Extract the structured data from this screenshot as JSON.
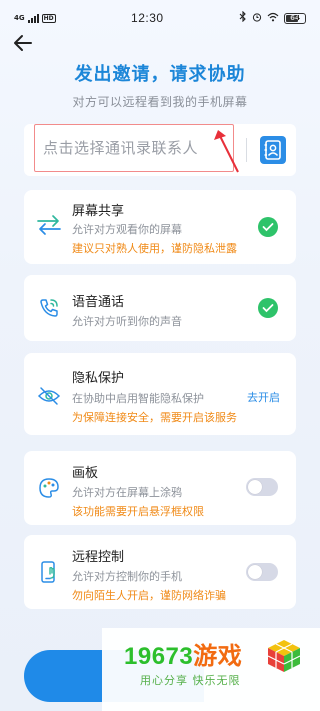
{
  "status_bar": {
    "network": "4G",
    "hd": "HD",
    "time": "12:30",
    "battery": "64"
  },
  "header": {
    "title": "发出邀请，请求协助",
    "subtitle": "对方可以远程看到我的手机屏幕"
  },
  "contact": {
    "placeholder": "点击选择通讯录联系人"
  },
  "cards": [
    {
      "title": "屏幕共享",
      "desc": "允许对方观看你的屏幕",
      "warn": "建议只对熟人使用，谨防隐私泄露",
      "icon": "swap-arrows-icon",
      "state": "checked"
    },
    {
      "title": "语音通话",
      "desc": "允许对方听到你的声音",
      "icon": "phone-call-icon",
      "state": "checked"
    },
    {
      "title": "隐私保护",
      "desc": "在协助中启用智能隐私保护",
      "warn": "为保障连接安全，需要开启该服务",
      "action": "去开启",
      "icon": "eye-hidden-icon"
    },
    {
      "title": "画板",
      "desc": "允许对方在屏幕上涂鸦",
      "warn": "该功能需要开启悬浮框权限",
      "icon": "palette-icon",
      "state": "off"
    },
    {
      "title": "远程控制",
      "desc": "允许对方控制你的手机",
      "warn": "勿向陌生人开启，谨防网络诈骗",
      "icon": "phone-touch-icon",
      "state": "off"
    }
  ],
  "watermark": {
    "number": "19673",
    "name": "游戏",
    "slogan": "用心分享  快乐无限"
  },
  "colors": {
    "accent": "#1c86d8",
    "check": "#2ec36a",
    "warn": "#f08a17",
    "link": "#2b8de6"
  }
}
